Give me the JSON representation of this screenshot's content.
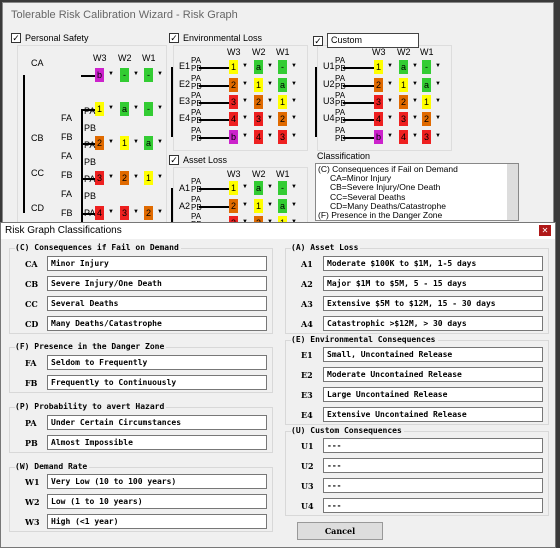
{
  "window": {
    "title": "Tolerable Risk Calibration Wizard - Risk Graph"
  },
  "colors": {
    "yellow": "#ffff00",
    "green": "#33cc33",
    "orange": "#e06a00",
    "red": "#ee2020",
    "magenta": "#cc22cc",
    "close": "#b01818"
  },
  "panels": {
    "personal": {
      "label": "Personal Safety",
      "checked": true,
      "cols": [
        "W3",
        "W2",
        "W1"
      ],
      "branches": [
        "CA",
        "CB",
        "CC",
        "CD"
      ],
      "f": [
        "FA",
        "FB",
        "FA",
        "FB",
        "FA",
        "FB"
      ],
      "p": [
        "PA",
        "PB",
        "PA",
        "PB",
        "PA",
        "PB",
        "PA"
      ],
      "rows": [
        [
          [
            "b",
            "magenta"
          ],
          [
            "-",
            "green"
          ],
          [
            "-",
            "green"
          ]
        ],
        [
          [
            "1",
            "yellow"
          ],
          [
            "a",
            "green"
          ],
          [
            "-",
            "green"
          ]
        ],
        [
          [
            "2",
            "orange"
          ],
          [
            "1",
            "yellow"
          ],
          [
            "a",
            "green"
          ]
        ],
        [
          [
            "3",
            "red"
          ],
          [
            "2",
            "orange"
          ],
          [
            "1",
            "yellow"
          ]
        ],
        [
          [
            "4",
            "red"
          ],
          [
            "3",
            "red"
          ],
          [
            "2",
            "orange"
          ]
        ]
      ]
    },
    "environmental": {
      "label": "Environmental Loss",
      "checked": true,
      "cols": [
        "W3",
        "W2",
        "W1"
      ],
      "branches": [
        "E1",
        "E2",
        "E3",
        "E4"
      ],
      "rows": [
        [
          [
            "1",
            "yellow"
          ],
          [
            "a",
            "green"
          ],
          [
            "-",
            "green"
          ]
        ],
        [
          [
            "2",
            "orange"
          ],
          [
            "1",
            "yellow"
          ],
          [
            "a",
            "green"
          ]
        ],
        [
          [
            "3",
            "red"
          ],
          [
            "2",
            "orange"
          ],
          [
            "1",
            "yellow"
          ]
        ],
        [
          [
            "4",
            "red"
          ],
          [
            "3",
            "red"
          ],
          [
            "2",
            "orange"
          ]
        ],
        [
          [
            "b",
            "magenta"
          ],
          [
            "4",
            "red"
          ],
          [
            "3",
            "red"
          ]
        ]
      ]
    },
    "custom": {
      "label": "Custom",
      "checked": true,
      "cols": [
        "W3",
        "W2",
        "W1"
      ],
      "branches": [
        "U1",
        "U2",
        "U3",
        "U4"
      ],
      "rows": [
        [
          [
            "1",
            "yellow"
          ],
          [
            "a",
            "green"
          ],
          [
            "-",
            "green"
          ]
        ],
        [
          [
            "2",
            "orange"
          ],
          [
            "1",
            "yellow"
          ],
          [
            "a",
            "green"
          ]
        ],
        [
          [
            "3",
            "red"
          ],
          [
            "2",
            "orange"
          ],
          [
            "1",
            "yellow"
          ]
        ],
        [
          [
            "4",
            "red"
          ],
          [
            "3",
            "red"
          ],
          [
            "2",
            "orange"
          ]
        ],
        [
          [
            "b",
            "magenta"
          ],
          [
            "4",
            "red"
          ],
          [
            "3",
            "red"
          ]
        ]
      ]
    },
    "asset": {
      "label": "Asset Loss",
      "checked": true,
      "cols": [
        "W3",
        "W2",
        "W1"
      ],
      "branches": [
        "A1",
        "A2"
      ],
      "rows": [
        [
          [
            "1",
            "yellow"
          ],
          [
            "a",
            "green"
          ],
          [
            "-",
            "green"
          ]
        ],
        [
          [
            "2",
            "orange"
          ],
          [
            "1",
            "yellow"
          ],
          [
            "a",
            "green"
          ]
        ],
        [
          [
            "3",
            "red"
          ],
          [
            "2",
            "orange"
          ],
          [
            "1",
            "yellow"
          ]
        ]
      ]
    }
  },
  "classification": {
    "label": "Classification",
    "lines": [
      "(C) Consequences if Fail on Demand",
      "CA=Minor Injury",
      "CB=Severe Injury/One Death",
      "CC=Several Deaths",
      "CD=Many Deaths/Catastrophe",
      "(F) Presence in the Danger Zone"
    ]
  },
  "dialog": {
    "title": "Risk Graph Classifications",
    "cancel": "Cancel",
    "groups": [
      {
        "title": "(C) Consequences if Fail on Demand",
        "items": [
          [
            "CA",
            "Minor Injury"
          ],
          [
            "CB",
            "Severe Injury/One Death"
          ],
          [
            "CC",
            "Several Deaths"
          ],
          [
            "CD",
            "Many Deaths/Catastrophe"
          ]
        ]
      },
      {
        "title": "(F) Presence in the Danger Zone",
        "items": [
          [
            "FA",
            "Seldom to Frequently"
          ],
          [
            "FB",
            "Frequently to Continuously"
          ]
        ]
      },
      {
        "title": "(P) Probability to avert Hazard",
        "items": [
          [
            "PA",
            "Under Certain Circumstances"
          ],
          [
            "PB",
            "Almost Impossible"
          ]
        ]
      },
      {
        "title": "(W) Demand Rate",
        "items": [
          [
            "W1",
            "Very Low (10 to 100 years)"
          ],
          [
            "W2",
            "Low (1 to 10 years)"
          ],
          [
            "W3",
            "High (<1 year)"
          ]
        ]
      },
      {
        "title": "(A) Asset Loss",
        "items": [
          [
            "A1",
            "Moderate $100K to $1M, 1-5 days"
          ],
          [
            "A2",
            "Major $1M to $5M, 5 - 15 days"
          ],
          [
            "A3",
            "Extensive $5M to $12M, 15 - 30 days"
          ],
          [
            "A4",
            "Catastrophic >$12M, > 30 days"
          ]
        ]
      },
      {
        "title": "(E) Environmental Consequences",
        "items": [
          [
            "E1",
            "Small, Uncontained Release"
          ],
          [
            "E2",
            "Moderate Uncontained Release"
          ],
          [
            "E3",
            "Large Uncontained Release"
          ],
          [
            "E4",
            "Extensive Uncontained Release"
          ]
        ]
      },
      {
        "title": "(U) Custom Consequences",
        "items": [
          [
            "U1",
            "---"
          ],
          [
            "U2",
            "---"
          ],
          [
            "U3",
            "---"
          ],
          [
            "U4",
            "---"
          ]
        ]
      }
    ]
  }
}
